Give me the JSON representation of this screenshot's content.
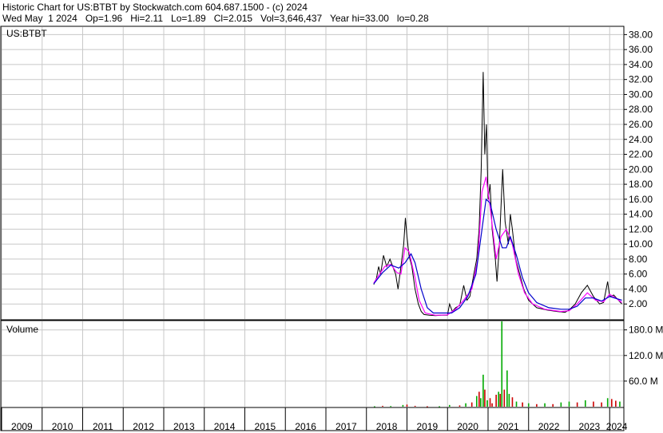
{
  "header": {
    "line1": "Historic Chart for US:BTBT by Stockwatch.com 604.687.1500 - (c) 2024",
    "line2": "Wed May  1 2024   Op=1.96   Hi=2.11   Lo=1.89   Cl=2.015   Vol=3,646,437   Year hi=33.00   lo=0.28"
  },
  "chart_data": [
    {
      "type": "line",
      "title": "US:BTBT",
      "ylabel": "",
      "ylim": [
        0,
        39
      ],
      "yticks": [
        "38.00",
        "36.00",
        "34.00",
        "32.00",
        "30.00",
        "28.00",
        "26.00",
        "24.00",
        "22.00",
        "20.00",
        "18.00",
        "16.00",
        "14.00",
        "12.00",
        "10.00",
        "8.00",
        "6.00",
        "4.00",
        "2.00"
      ],
      "grid": true,
      "series": [
        {
          "color": "#000000",
          "points": [
            [
              2018.18,
              4.6
            ],
            [
              2018.25,
              5.5
            ],
            [
              2018.3,
              7.0
            ],
            [
              2018.35,
              6.0
            ],
            [
              2018.42,
              8.5
            ],
            [
              2018.5,
              7.0
            ],
            [
              2018.58,
              8.0
            ],
            [
              2018.65,
              7.0
            ],
            [
              2018.72,
              6.0
            ],
            [
              2018.78,
              4.0
            ],
            [
              2018.85,
              7.0
            ],
            [
              2018.92,
              10.0
            ],
            [
              2018.96,
              13.5
            ],
            [
              2019.0,
              11.0
            ],
            [
              2019.05,
              8.5
            ],
            [
              2019.12,
              7.0
            ],
            [
              2019.2,
              4.0
            ],
            [
              2019.28,
              2.0
            ],
            [
              2019.35,
              1.0
            ],
            [
              2019.42,
              0.6
            ],
            [
              2019.55,
              0.5
            ],
            [
              2019.7,
              0.45
            ],
            [
              2019.85,
              0.5
            ],
            [
              2020.0,
              0.5
            ],
            [
              2020.05,
              2.0
            ],
            [
              2020.12,
              1.0
            ],
            [
              2020.2,
              1.5
            ],
            [
              2020.3,
              1.8
            ],
            [
              2020.4,
              4.5
            ],
            [
              2020.48,
              2.5
            ],
            [
              2020.55,
              3.0
            ],
            [
              2020.65,
              6.0
            ],
            [
              2020.72,
              8.0
            ],
            [
              2020.78,
              12.0
            ],
            [
              2020.83,
              20.0
            ],
            [
              2020.88,
              33.0
            ],
            [
              2020.92,
              22.0
            ],
            [
              2020.96,
              26.0
            ],
            [
              2021.0,
              16.0
            ],
            [
              2021.05,
              18.0
            ],
            [
              2021.1,
              12.0
            ],
            [
              2021.18,
              8.0
            ],
            [
              2021.22,
              5.0
            ],
            [
              2021.28,
              10.0
            ],
            [
              2021.32,
              15.0
            ],
            [
              2021.36,
              20.0
            ],
            [
              2021.42,
              13.0
            ],
            [
              2021.5,
              10.0
            ],
            [
              2021.55,
              14.0
            ],
            [
              2021.6,
              12.0
            ],
            [
              2021.68,
              8.0
            ],
            [
              2021.78,
              6.0
            ],
            [
              2021.88,
              4.0
            ],
            [
              2022.0,
              2.5
            ],
            [
              2022.2,
              1.5
            ],
            [
              2022.45,
              1.2
            ],
            [
              2022.7,
              1.0
            ],
            [
              2022.9,
              0.9
            ],
            [
              2023.0,
              1.2
            ],
            [
              2023.15,
              2.0
            ],
            [
              2023.3,
              3.5
            ],
            [
              2023.45,
              4.5
            ],
            [
              2023.6,
              3.0
            ],
            [
              2023.75,
              2.0
            ],
            [
              2023.85,
              2.2
            ],
            [
              2023.95,
              5.0
            ],
            [
              2024.0,
              3.0
            ],
            [
              2024.1,
              3.2
            ],
            [
              2024.2,
              2.6
            ],
            [
              2024.3,
              2.0
            ]
          ]
        },
        {
          "color": "#ff00ff",
          "points": [
            [
              2018.18,
              4.8
            ],
            [
              2018.3,
              5.8
            ],
            [
              2018.45,
              7.0
            ],
            [
              2018.6,
              7.3
            ],
            [
              2018.75,
              6.2
            ],
            [
              2018.85,
              6.0
            ],
            [
              2018.95,
              9.5
            ],
            [
              2019.05,
              9.0
            ],
            [
              2019.2,
              5.5
            ],
            [
              2019.3,
              2.5
            ],
            [
              2019.45,
              0.8
            ],
            [
              2019.7,
              0.5
            ],
            [
              2020.0,
              0.55
            ],
            [
              2020.2,
              1.3
            ],
            [
              2020.4,
              2.5
            ],
            [
              2020.6,
              4.0
            ],
            [
              2020.75,
              8.0
            ],
            [
              2020.85,
              17.0
            ],
            [
              2020.95,
              19.0
            ],
            [
              2021.05,
              15.0
            ],
            [
              2021.2,
              8.0
            ],
            [
              2021.32,
              11.0
            ],
            [
              2021.45,
              12.0
            ],
            [
              2021.6,
              10.0
            ],
            [
              2021.75,
              6.0
            ],
            [
              2021.9,
              3.5
            ],
            [
              2022.1,
              2.0
            ],
            [
              2022.4,
              1.3
            ],
            [
              2022.8,
              1.0
            ],
            [
              2023.0,
              1.1
            ],
            [
              2023.2,
              2.0
            ],
            [
              2023.45,
              3.5
            ],
            [
              2023.65,
              2.5
            ],
            [
              2023.85,
              2.3
            ],
            [
              2024.0,
              3.3
            ],
            [
              2024.15,
              2.8
            ],
            [
              2024.3,
              2.2
            ]
          ]
        },
        {
          "color": "#0000cc",
          "points": [
            [
              2018.18,
              4.7
            ],
            [
              2018.4,
              6.2
            ],
            [
              2018.6,
              7.2
            ],
            [
              2018.8,
              6.8
            ],
            [
              2018.95,
              7.5
            ],
            [
              2019.1,
              8.7
            ],
            [
              2019.2,
              7.5
            ],
            [
              2019.35,
              4.0
            ],
            [
              2019.5,
              1.5
            ],
            [
              2019.65,
              0.8
            ],
            [
              2019.9,
              0.8
            ],
            [
              2020.1,
              0.8
            ],
            [
              2020.3,
              1.5
            ],
            [
              2020.5,
              3.0
            ],
            [
              2020.7,
              6.0
            ],
            [
              2020.85,
              12.0
            ],
            [
              2020.95,
              16.0
            ],
            [
              2021.05,
              15.5
            ],
            [
              2021.2,
              12.0
            ],
            [
              2021.35,
              9.5
            ],
            [
              2021.45,
              9.5
            ],
            [
              2021.55,
              11.0
            ],
            [
              2021.7,
              8.5
            ],
            [
              2021.85,
              5.5
            ],
            [
              2022.0,
              3.5
            ],
            [
              2022.2,
              2.2
            ],
            [
              2022.5,
              1.5
            ],
            [
              2022.8,
              1.3
            ],
            [
              2023.0,
              1.3
            ],
            [
              2023.2,
              1.7
            ],
            [
              2023.4,
              2.8
            ],
            [
              2023.6,
              2.8
            ],
            [
              2023.8,
              2.4
            ],
            [
              2024.0,
              3.0
            ],
            [
              2024.3,
              2.5
            ]
          ]
        }
      ]
    },
    {
      "type": "bar",
      "title": "Volume",
      "ylim": [
        0,
        200
      ],
      "yticks": [
        "180.0 M",
        "120.0 M",
        "60.0 M"
      ],
      "grid": true,
      "bars": [
        [
          2018.2,
          1,
          "#00aa00"
        ],
        [
          2018.4,
          2,
          "#cc0000"
        ],
        [
          2018.6,
          1.5,
          "#00aa00"
        ],
        [
          2018.9,
          4,
          "#00aa00"
        ],
        [
          2019.0,
          5,
          "#cc0000"
        ],
        [
          2019.2,
          2,
          "#cc0000"
        ],
        [
          2019.5,
          1,
          "#cc0000"
        ],
        [
          2019.8,
          1,
          "#00aa00"
        ],
        [
          2020.05,
          4,
          "#00aa00"
        ],
        [
          2020.3,
          3,
          "#cc0000"
        ],
        [
          2020.45,
          8,
          "#00aa00"
        ],
        [
          2020.6,
          10,
          "#cc0000"
        ],
        [
          2020.72,
          25,
          "#00aa00"
        ],
        [
          2020.78,
          35,
          "#cc0000"
        ],
        [
          2020.82,
          20,
          "#00aa00"
        ],
        [
          2020.88,
          75,
          "#00aa00"
        ],
        [
          2020.92,
          40,
          "#cc0000"
        ],
        [
          2020.98,
          15,
          "#00aa00"
        ],
        [
          2021.05,
          20,
          "#cc0000"
        ],
        [
          2021.1,
          8,
          "#cc0000"
        ],
        [
          2021.2,
          28,
          "#cc0000"
        ],
        [
          2021.26,
          35,
          "#00aa00"
        ],
        [
          2021.3,
          30,
          "#cc0000"
        ],
        [
          2021.34,
          200,
          "#00aa00"
        ],
        [
          2021.4,
          40,
          "#cc0000"
        ],
        [
          2021.47,
          85,
          "#00aa00"
        ],
        [
          2021.52,
          30,
          "#00aa00"
        ],
        [
          2021.6,
          22,
          "#cc0000"
        ],
        [
          2021.7,
          12,
          "#00aa00"
        ],
        [
          2021.85,
          10,
          "#cc0000"
        ],
        [
          2022.0,
          8,
          "#00aa00"
        ],
        [
          2022.2,
          6,
          "#cc0000"
        ],
        [
          2022.4,
          8,
          "#00aa00"
        ],
        [
          2022.6,
          6,
          "#cc0000"
        ],
        [
          2022.8,
          10,
          "#00aa00"
        ],
        [
          2023.0,
          12,
          "#00aa00"
        ],
        [
          2023.2,
          10,
          "#cc0000"
        ],
        [
          2023.4,
          15,
          "#00aa00"
        ],
        [
          2023.6,
          12,
          "#cc0000"
        ],
        [
          2023.8,
          10,
          "#cc0000"
        ],
        [
          2023.95,
          20,
          "#00aa00"
        ],
        [
          2024.05,
          18,
          "#cc0000"
        ],
        [
          2024.15,
          14,
          "#cc0000"
        ],
        [
          2024.25,
          12,
          "#00aa00"
        ]
      ]
    }
  ],
  "xaxis": {
    "labels": [
      "2009",
      "2010",
      "2011",
      "2012",
      "2013",
      "2014",
      "2015",
      "2016",
      "2017",
      "2018",
      "2019",
      "2020",
      "2021",
      "2022",
      "2023",
      "2024"
    ],
    "start": 2009.0,
    "end": 2024.35
  }
}
